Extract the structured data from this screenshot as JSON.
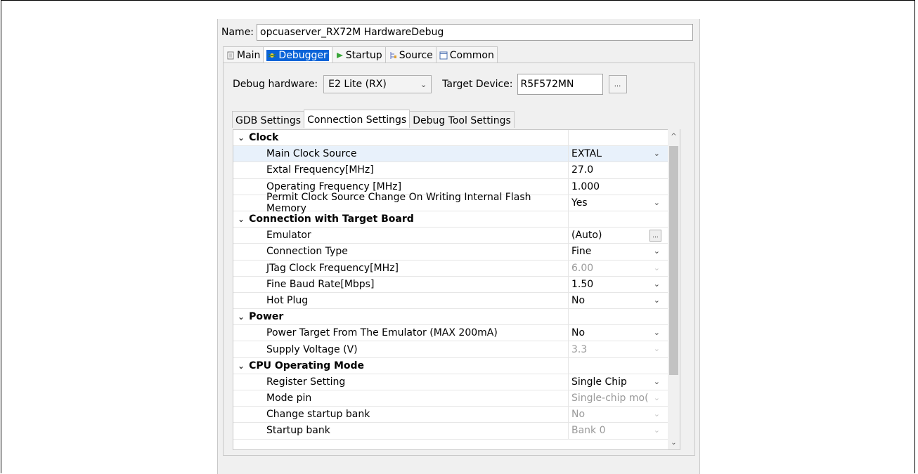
{
  "dialog": {
    "name_label": "Name:",
    "name_value": "opcuaserver_RX72M HardwareDebug"
  },
  "tabs": [
    {
      "label": "Main",
      "icon": "document-icon"
    },
    {
      "label": "Debugger",
      "icon": "bug-icon",
      "selected": true
    },
    {
      "label": "Startup",
      "icon": "play-icon"
    },
    {
      "label": "Source",
      "icon": "source-icon"
    },
    {
      "label": "Common",
      "icon": "window-icon"
    }
  ],
  "debug_hardware": {
    "label": "Debug hardware:",
    "value": "E2 Lite (RX)"
  },
  "target_device": {
    "label": "Target Device:",
    "value": "R5F572MN",
    "browse": "..."
  },
  "inner_tabs": [
    "GDB Settings",
    "Connection Settings",
    "Debug Tool Settings"
  ],
  "groups": {
    "clock": {
      "label": "Clock",
      "items": [
        {
          "key": "Main Clock Source",
          "value": "EXTAL"
        },
        {
          "key": "Extal Frequency[MHz]",
          "value": "27.0"
        },
        {
          "key": "Operating Frequency [MHz]",
          "value": "1.000"
        },
        {
          "key": "Permit Clock Source Change On Writing Internal Flash Memory",
          "value": "Yes"
        }
      ]
    },
    "connection": {
      "label": "Connection with Target Board",
      "items": [
        {
          "key": "Emulator",
          "value": "(Auto)",
          "button": "..."
        },
        {
          "key": "Connection Type",
          "value": "Fine"
        },
        {
          "key": "JTag Clock Frequency[MHz]",
          "value": "6.00"
        },
        {
          "key": "Fine Baud Rate[Mbps]",
          "value": "1.50"
        },
        {
          "key": "Hot Plug",
          "value": "No"
        }
      ]
    },
    "power": {
      "label": "Power",
      "items": [
        {
          "key": "Power Target From The Emulator (MAX 200mA)",
          "value": "No"
        },
        {
          "key": "Supply Voltage (V)",
          "value": "3.3"
        }
      ]
    },
    "cpu": {
      "label": "CPU Operating Mode",
      "items": [
        {
          "key": "Register Setting",
          "value": "Single Chip"
        },
        {
          "key": "Mode pin",
          "value": "Single-chip mo("
        },
        {
          "key": "Change startup bank",
          "value": "No"
        },
        {
          "key": "Startup bank",
          "value": "Bank 0"
        }
      ]
    }
  },
  "glyphs": {
    "chevron_down": "⌄",
    "chevron_right_open": "⌄",
    "dropdown": "⌄",
    "scroll_up": "^",
    "scroll_down": "⌄"
  },
  "colors": {
    "selection": "#0a64d8",
    "row_selected": "#e8f1fb"
  }
}
